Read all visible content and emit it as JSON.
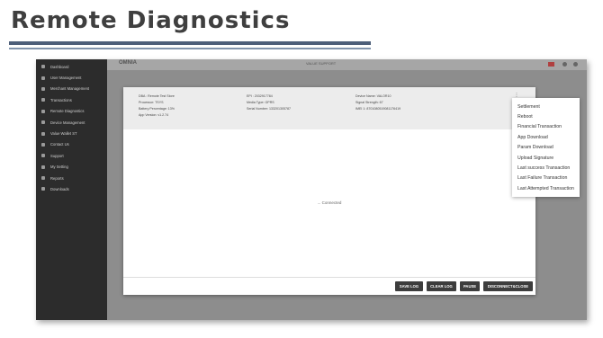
{
  "slide": {
    "title": "Remote Diagnostics"
  },
  "app": {
    "brand": "OMNIA",
    "top_center": "VALUE SUPPORT"
  },
  "sidebar": {
    "items": [
      {
        "label": "Dashboard"
      },
      {
        "label": "User Management"
      },
      {
        "label": "Merchant Management"
      },
      {
        "label": "Transactions"
      },
      {
        "label": "Remote Diagnostics"
      },
      {
        "label": "Device Management"
      },
      {
        "label": "Value Wallet ST"
      },
      {
        "label": "Contact Us"
      },
      {
        "label": "Support"
      },
      {
        "label": "My Setting"
      },
      {
        "label": "Reports"
      },
      {
        "label": "Downloads"
      }
    ]
  },
  "device_info": {
    "dba": "DBA : Remote Test Store",
    "processor": "Processor: TSYS",
    "battery": "Battery Percentage: 13%",
    "app_version": "App Version: v1.2.74",
    "epi": "EPI : 2032917784",
    "media_type": "Media Type: GPRS",
    "serial": "Serial Number: 133201305787",
    "device_name": "Device Name: VALOR10",
    "signal": "Signal Strength: 67",
    "imei": "IMEI 1: 8701080519081176419"
  },
  "status_text": "... Connected",
  "buttons": {
    "save_log": "SAVE LOG",
    "clear_log": "CLEAR LOG",
    "pause": "PAUSE",
    "disconnect_close": "DISCONNECT&CLOSE"
  },
  "menu": {
    "items": [
      {
        "label": "Settlement"
      },
      {
        "label": "Reboot"
      },
      {
        "label": "Financial Transaction"
      },
      {
        "label": "App Download"
      },
      {
        "label": "Param Download"
      },
      {
        "label": "Upload Signature"
      },
      {
        "label": "Last success Transaction"
      },
      {
        "label": "Last Failure Transaction"
      },
      {
        "label": "Last Attempted Transaction"
      }
    ]
  }
}
